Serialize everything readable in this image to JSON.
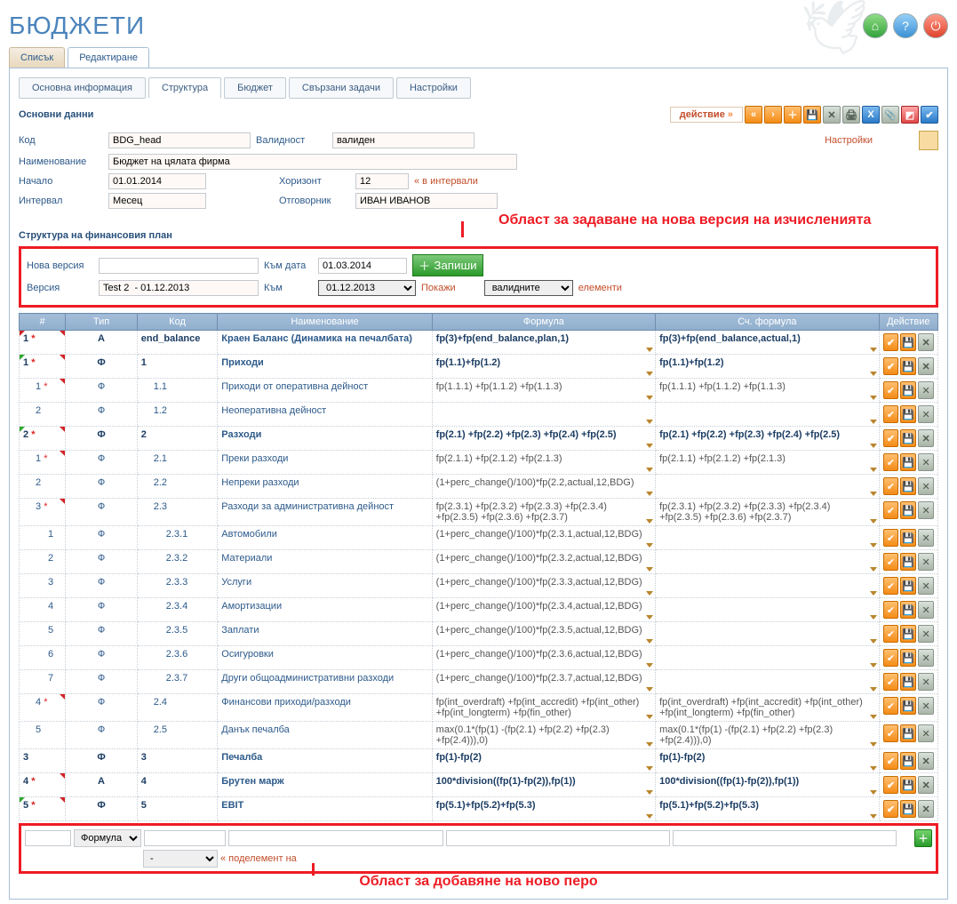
{
  "page_title": "БЮДЖЕТИ",
  "tabs1": {
    "list": "Списък",
    "edit": "Редактиране"
  },
  "tabs2": {
    "main": "Основна информация",
    "struct": "Структура",
    "budget": "Бюджет",
    "tasks": "Свързани задачи",
    "settings": "Настройки"
  },
  "section_main": "Основни данни",
  "action_link": "действие",
  "settings_label": "Настройки",
  "fields": {
    "code_l": "Код",
    "code_v": "BDG_head",
    "name_l": "Наименование",
    "name_v": "Бюджет на цялата фирма",
    "valid_l": "Валидност",
    "valid_v": "валиден",
    "start_l": "Начало",
    "start_v": "01.01.2014",
    "hor_l": "Хоризонт",
    "hor_v": "12",
    "hor_hint": "« в интервали",
    "interval_l": "Интервал",
    "interval_v": "Месец",
    "resp_l": "Отговорник",
    "resp_v": "ИВАН ИВАНОВ"
  },
  "annotation1": "Област за задаване на нова версия на изчисленията",
  "section2": "Структура на финансовия план",
  "version_box": {
    "new_l": "Нова версия",
    "todate_l": "Към дата",
    "todate_v": "01.03.2014",
    "save": "Запиши",
    "ver_l": "Версия",
    "ver_v": "Test 2  - 01.12.2013",
    "to_l": "Към",
    "to_v": "01.12.2013",
    "show": "Покажи",
    "filter_v": "валидните",
    "elements": "елементи"
  },
  "cols": {
    "n": "#",
    "type": "Тип",
    "code": "Код",
    "name": "Наименование",
    "formula": "Формула",
    "acc_formula": "Сч. формула",
    "act": "Действие"
  },
  "rows": [
    {
      "i": "1 *",
      "lvl": 0,
      "ml": "r",
      "mr": "r",
      "t": "А",
      "c": "end_balance",
      "n": "Краен Баланс (Динамика на печалбата)",
      "f": "fp(3)+fp(end_balance,plan,1)",
      "af": "fp(3)+fp(end_balance,actual,1)",
      "b": 1
    },
    {
      "i": "1 *",
      "lvl": 0,
      "ml": "g",
      "mr": "r",
      "t": "Ф",
      "c": "1",
      "n": "Приходи",
      "f": "fp(1.1)+fp(1.2)",
      "af": "fp(1.1)+fp(1.2)",
      "b": 1
    },
    {
      "i": "1 *",
      "lvl": 1,
      "ml": "",
      "mr": "r",
      "t": "Ф",
      "c": "1.1",
      "n": "Приходи от оперативна дейност",
      "f": "fp(1.1.1) +fp(1.1.2) +fp(1.1.3)",
      "af": "fp(1.1.1) +fp(1.1.2) +fp(1.1.3)"
    },
    {
      "i": "2",
      "lvl": 1,
      "t": "Ф",
      "c": "1.2",
      "n": "Неоперативна дейност",
      "f": "",
      "af": ""
    },
    {
      "i": "2 *",
      "lvl": 0,
      "ml": "g",
      "mr": "r",
      "t": "Ф",
      "c": "2",
      "n": "Разходи",
      "f": "fp(2.1) +fp(2.2) +fp(2.3) +fp(2.4) +fp(2.5)",
      "af": "fp(2.1) +fp(2.2) +fp(2.3) +fp(2.4) +fp(2.5)",
      "b": 1
    },
    {
      "i": "1 *",
      "lvl": 1,
      "mr": "r",
      "t": "Ф",
      "c": "2.1",
      "n": "Преки разходи",
      "f": "fp(2.1.1) +fp(2.1.2) +fp(2.1.3)",
      "af": "fp(2.1.1) +fp(2.1.2) +fp(2.1.3)"
    },
    {
      "i": "2",
      "lvl": 1,
      "t": "Ф",
      "c": "2.2",
      "n": "Непреки разходи",
      "f": "(1+perc_change()/100)*fp(2.2,actual,12,BDG)",
      "af": ""
    },
    {
      "i": "3 *",
      "lvl": 1,
      "mr": "r",
      "t": "Ф",
      "c": "2.3",
      "n": "Разходи за административна дейност",
      "f": "fp(2.3.1) +fp(2.3.2) +fp(2.3.3) +fp(2.3.4) +fp(2.3.5) +fp(2.3.6) +fp(2.3.7)",
      "af": "fp(2.3.1) +fp(2.3.2) +fp(2.3.3) +fp(2.3.4) +fp(2.3.5) +fp(2.3.6) +fp(2.3.7)"
    },
    {
      "i": "1",
      "lvl": 2,
      "t": "Ф",
      "c": "2.3.1",
      "n": "Автомобили",
      "f": "(1+perc_change()/100)*fp(2.3.1,actual,12,BDG)",
      "af": ""
    },
    {
      "i": "2",
      "lvl": 2,
      "t": "Ф",
      "c": "2.3.2",
      "n": "Материали",
      "f": "(1+perc_change()/100)*fp(2.3.2,actual,12,BDG)",
      "af": ""
    },
    {
      "i": "3",
      "lvl": 2,
      "t": "Ф",
      "c": "2.3.3",
      "n": "Услуги",
      "f": "(1+perc_change()/100)*fp(2.3.3,actual,12,BDG)",
      "af": ""
    },
    {
      "i": "4",
      "lvl": 2,
      "t": "Ф",
      "c": "2.3.4",
      "n": "Амортизации",
      "f": "(1+perc_change()/100)*fp(2.3.4,actual,12,BDG)",
      "af": ""
    },
    {
      "i": "5",
      "lvl": 2,
      "t": "Ф",
      "c": "2.3.5",
      "n": "Заплати",
      "f": "(1+perc_change()/100)*fp(2.3.5,actual,12,BDG)",
      "af": ""
    },
    {
      "i": "6",
      "lvl": 2,
      "t": "Ф",
      "c": "2.3.6",
      "n": "Осигуровки",
      "f": "(1+perc_change()/100)*fp(2.3.6,actual,12,BDG)",
      "af": ""
    },
    {
      "i": "7",
      "lvl": 2,
      "t": "Ф",
      "c": "2.3.7",
      "n": "Други общоадминистративни разходи",
      "f": "(1+perc_change()/100)*fp(2.3.7,actual,12,BDG)",
      "af": ""
    },
    {
      "i": "4 *",
      "lvl": 1,
      "mr": "r",
      "t": "Ф",
      "c": "2.4",
      "n": "Финансови приходи/разходи",
      "f": "fp(int_overdraft) +fp(int_accredit) +fp(int_other) +fp(int_longterm) +fp(fin_other)",
      "af": "fp(int_overdraft) +fp(int_accredit) +fp(int_other) +fp(int_longterm) +fp(fin_other)"
    },
    {
      "i": "5",
      "lvl": 1,
      "t": "Ф",
      "c": "2.5",
      "n": "Данък печалба",
      "f": "max(0.1*(fp(1) -(fp(2.1) +fp(2.2) +fp(2.3) +fp(2.4))),0)",
      "af": "max(0.1*(fp(1) -(fp(2.1) +fp(2.2) +fp(2.3) +fp(2.4))),0)"
    },
    {
      "i": "3",
      "lvl": 0,
      "t": "Ф",
      "c": "3",
      "n": "Печалба",
      "f": "fp(1)-fp(2)",
      "af": "fp(1)-fp(2)",
      "b": 1
    },
    {
      "i": "4 *",
      "lvl": 0,
      "mr": "r",
      "t": "А",
      "c": "4",
      "n": "Брутен марж",
      "f": "100*division((fp(1)-fp(2)),fp(1))",
      "af": "100*division((fp(1)-fp(2)),fp(1))",
      "b": 1
    },
    {
      "i": "5 *",
      "lvl": 0,
      "ml": "g",
      "mr": "r",
      "t": "Ф",
      "c": "5",
      "n": "EBIT",
      "f": "fp(5.1)+fp(5.2)+fp(5.3)",
      "af": "fp(5.1)+fp(5.2)+fp(5.3)",
      "b": 1
    }
  ],
  "addrow": {
    "type_opt": "Формула",
    "parent_sel": "-",
    "sub_hint": "« поделемент на"
  },
  "annotation2": "Област за добавяне на ново перо"
}
